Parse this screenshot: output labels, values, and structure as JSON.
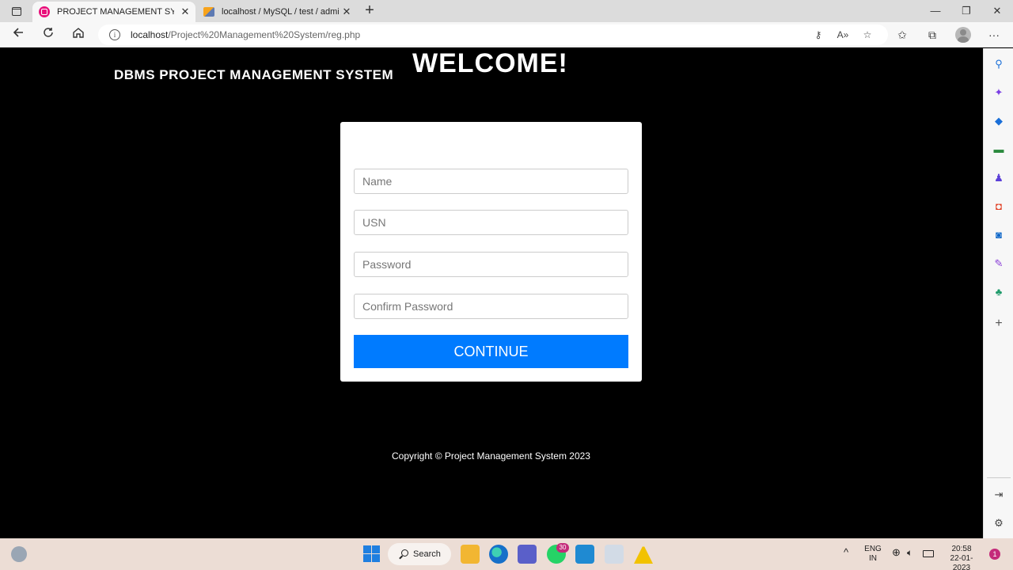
{
  "browser": {
    "tabs": [
      {
        "title": "PROJECT MANAGEMENT SYSTEM",
        "close": "✕"
      },
      {
        "title": "localhost / MySQL / test / admin",
        "close": "✕"
      }
    ],
    "new_tab": "+",
    "url_host": "localhost",
    "url_path": "/Project%20Management%20System/reg.php"
  },
  "page": {
    "brand": "DBMS PROJECT MANAGEMENT SYSTEM",
    "heading": "WELCOME!",
    "form": {
      "name_placeholder": "Name",
      "usn_placeholder": "USN",
      "password_placeholder": "Password",
      "confirm_placeholder": "Confirm Password",
      "submit_label": "CONTINUE"
    },
    "footer": "Copyright © Project Management System 2023",
    "accent_color": "#007bff"
  },
  "taskbar": {
    "search_label": "Search",
    "whatsapp_badge": "30",
    "language": "ENG",
    "region": "IN",
    "time": "20:58",
    "date": "22-01-2023",
    "notification_count": "1"
  }
}
